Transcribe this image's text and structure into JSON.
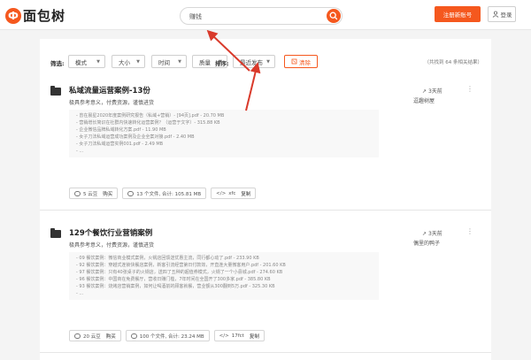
{
  "header": {
    "logo_glyph": "Ф",
    "logo_text": "面包树",
    "search_value": "赚钱",
    "search_icon": "search-icon",
    "register_label": "注册新账号",
    "login_label": "登录"
  },
  "filters": {
    "label": "筛选:",
    "options": [
      {
        "label": "模式"
      },
      {
        "label": "大小"
      },
      {
        "label": "时间"
      },
      {
        "label": "质量"
      }
    ],
    "sort_label": "排序:",
    "sort_value": "最近发布",
    "clear_label": "清除",
    "result_count": "（共找到 64 条相关结果）"
  },
  "items": [
    {
      "title": "私域流量运营案例-13份",
      "tagline": "极具参考意义，付费资源，谨慎进货",
      "files": [
        "- 曾在晨星2020年度案例研究报告（私域+营销）- [94页].pdf - 20.70 MB",
        "- 营销增长简识在社群内快速转化运营案例？（运营于文字）- 315.88 KB",
        "- 企业微信品牌私域转化方案.pdf - 11.90 MB",
        "- 女子刀法私域运营成功案例及企业全案对接.pdf - 2.40 MB",
        "- 女子刀法私域运营实例001.pdf - 2.49 MB",
        "- ..."
      ],
      "price": "5 云豆",
      "buy_label": "购买",
      "file_summary": "13 个文件, 合计: 105.81 MB",
      "format": "xfc",
      "copy_label": "复制",
      "shares": "3天前",
      "sharer": "逗趣树屋"
    },
    {
      "title": "129个餐饮行业营销案例",
      "tagline": "极具参考意义，付费资源，谨慎进货",
      "files": [
        "- 09 餐饮案例：微信商业模式案例，火锅店回馈送优惠主流，同行都心动了.pdf - 233.90 KB",
        "- 92 餐饮案例：穿越式连锁快餐店案例，新客引流经营第日付款效，开直连大量微客用户.pdf - 201.60 KB",
        "- 97 餐饮案例：只有40张桌子的火锅店，送四了五种的超值券模式，火锅了一个小县城.pdf - 274.60 KB",
        "- 96 餐饮案例：中国商在免费餐厅，营收日赚门槛，7年时间在全国开了300多家.pdf - 385.80 KB",
        "- 93 餐饮案例：烧烤店营销案例，如何让喝酒前的顾客就餐，营业额从300翻到5万.pdf - 325.30 KB",
        "- ..."
      ],
      "price": "20 云豆",
      "buy_label": "购买",
      "file_summary": "100 个文件, 合计: 23.24 MB",
      "format": "17fct",
      "copy_label": "复制",
      "shares": "3天前",
      "sharer": "偶里的鸭子"
    }
  ]
}
